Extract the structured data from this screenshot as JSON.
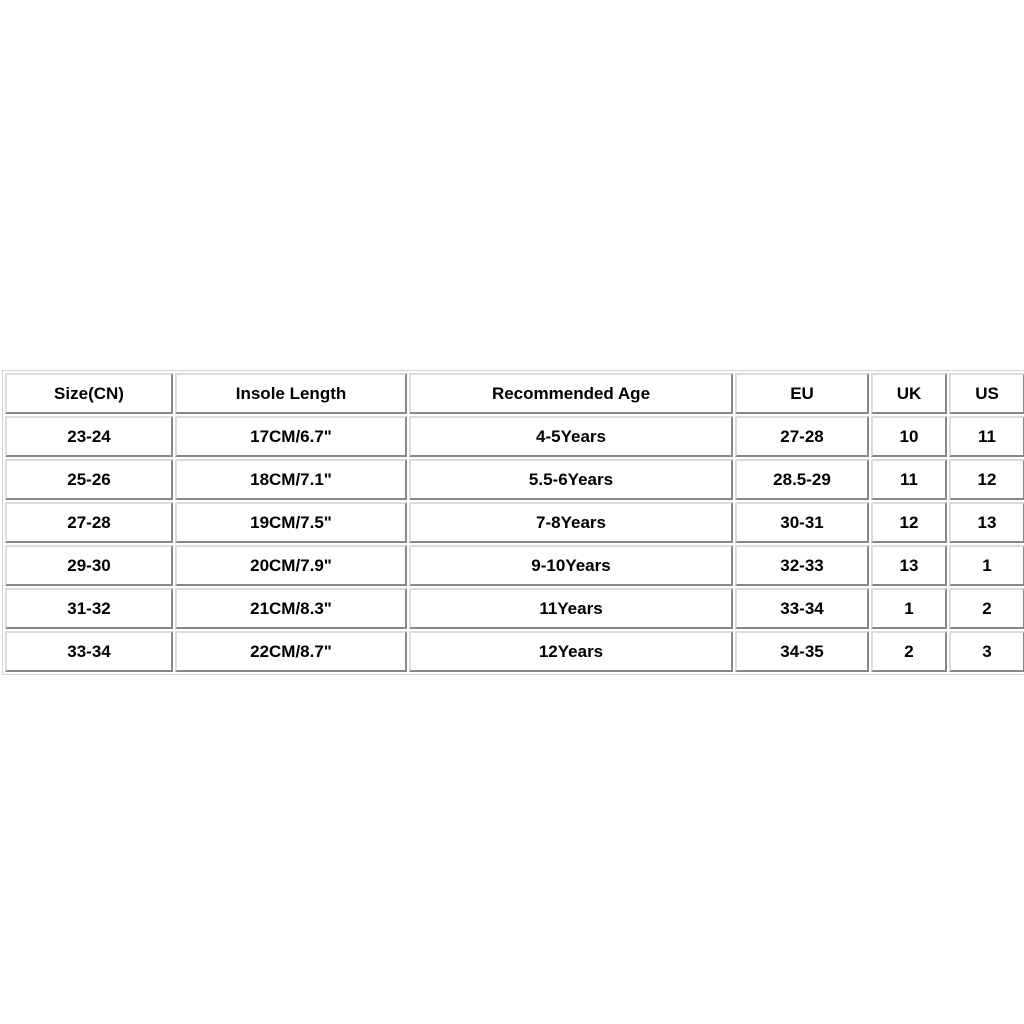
{
  "table": {
    "columns": [
      {
        "key": "size_cn",
        "label": "Size(CN)"
      },
      {
        "key": "insole_length",
        "label": "Insole Length"
      },
      {
        "key": "recommended_age",
        "label": "Recommended Age"
      },
      {
        "key": "eu",
        "label": "EU"
      },
      {
        "key": "uk",
        "label": "UK"
      },
      {
        "key": "us",
        "label": "US"
      }
    ],
    "rows": [
      {
        "size_cn": "23-24",
        "insole_length": "17CM/6.7\"",
        "recommended_age": "4-5Years",
        "eu": "27-28",
        "uk": "10",
        "us": "11"
      },
      {
        "size_cn": "25-26",
        "insole_length": "18CM/7.1\"",
        "recommended_age": "5.5-6Years",
        "eu": "28.5-29",
        "uk": "11",
        "us": "12"
      },
      {
        "size_cn": "27-28",
        "insole_length": "19CM/7.5\"",
        "recommended_age": "7-8Years",
        "eu": "30-31",
        "uk": "12",
        "us": "13"
      },
      {
        "size_cn": "29-30",
        "insole_length": "20CM/7.9\"",
        "recommended_age": "9-10Years",
        "eu": "32-33",
        "uk": "13",
        "us": "1"
      },
      {
        "size_cn": "31-32",
        "insole_length": "21CM/8.3\"",
        "recommended_age": "11Years",
        "eu": "33-34",
        "uk": "1",
        "us": "2"
      },
      {
        "size_cn": "33-34",
        "insole_length": "22CM/8.7\"",
        "recommended_age": "12Years",
        "eu": "34-35",
        "uk": "2",
        "us": "3"
      }
    ]
  },
  "colors": {
    "page_background": "#ffffff",
    "cell_background": "#ffffff",
    "text": "#000000",
    "border": "#dcdcdc"
  }
}
